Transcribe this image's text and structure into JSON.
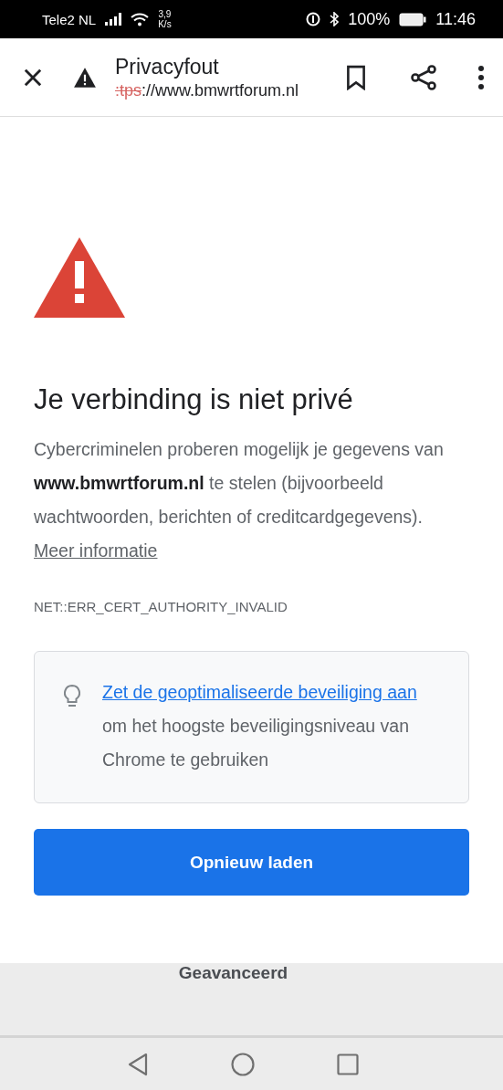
{
  "status_bar": {
    "carrier": "Tele2 NL",
    "speed_value": "3,9",
    "speed_unit": "K/s",
    "battery": "100%",
    "time": "11:46"
  },
  "toolbar": {
    "title": "Privacyfout",
    "url_scheme": ":tps",
    "url_rest": "://www.bmwrtforum.nl"
  },
  "heading": "Je verbinding is niet privé",
  "message": "Cybercriminelen proberen mogelijk je gegevens van **www.bmwrtforum.nl** te stelen (bijvoorbeeld wachtwoorden, berichten of creditcardgegevens).",
  "more_info_link": "Meer informatie",
  "error_code": "NET::ERR_CERT_AUTHORITY_INVALID",
  "tip": {
    "link": "Zet de geoptimaliseerde beveiliging aan",
    "text": "om het hoogste beveiligingsniveau van Chrome te gebruiken"
  },
  "reload_button": "Opnieuw laden",
  "advanced_button": "Geavanceerd"
}
